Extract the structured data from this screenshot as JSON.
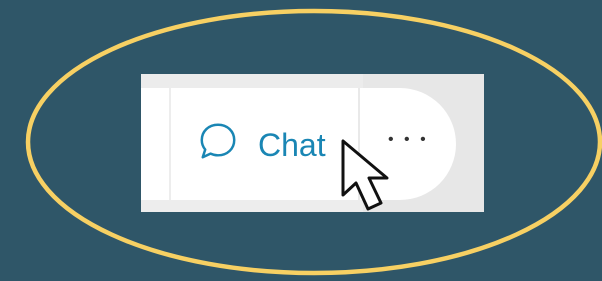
{
  "colors": {
    "background": "#2f5668",
    "highlight_ring": "#f7d063",
    "chat_accent": "#1a86b4"
  },
  "chat_button": {
    "label": "Chat",
    "icon": "chat-bubble-icon"
  },
  "more_button": {
    "label": "• • •",
    "icon": "more-options-icon"
  },
  "cursor": {
    "icon": "mouse-pointer-icon"
  }
}
